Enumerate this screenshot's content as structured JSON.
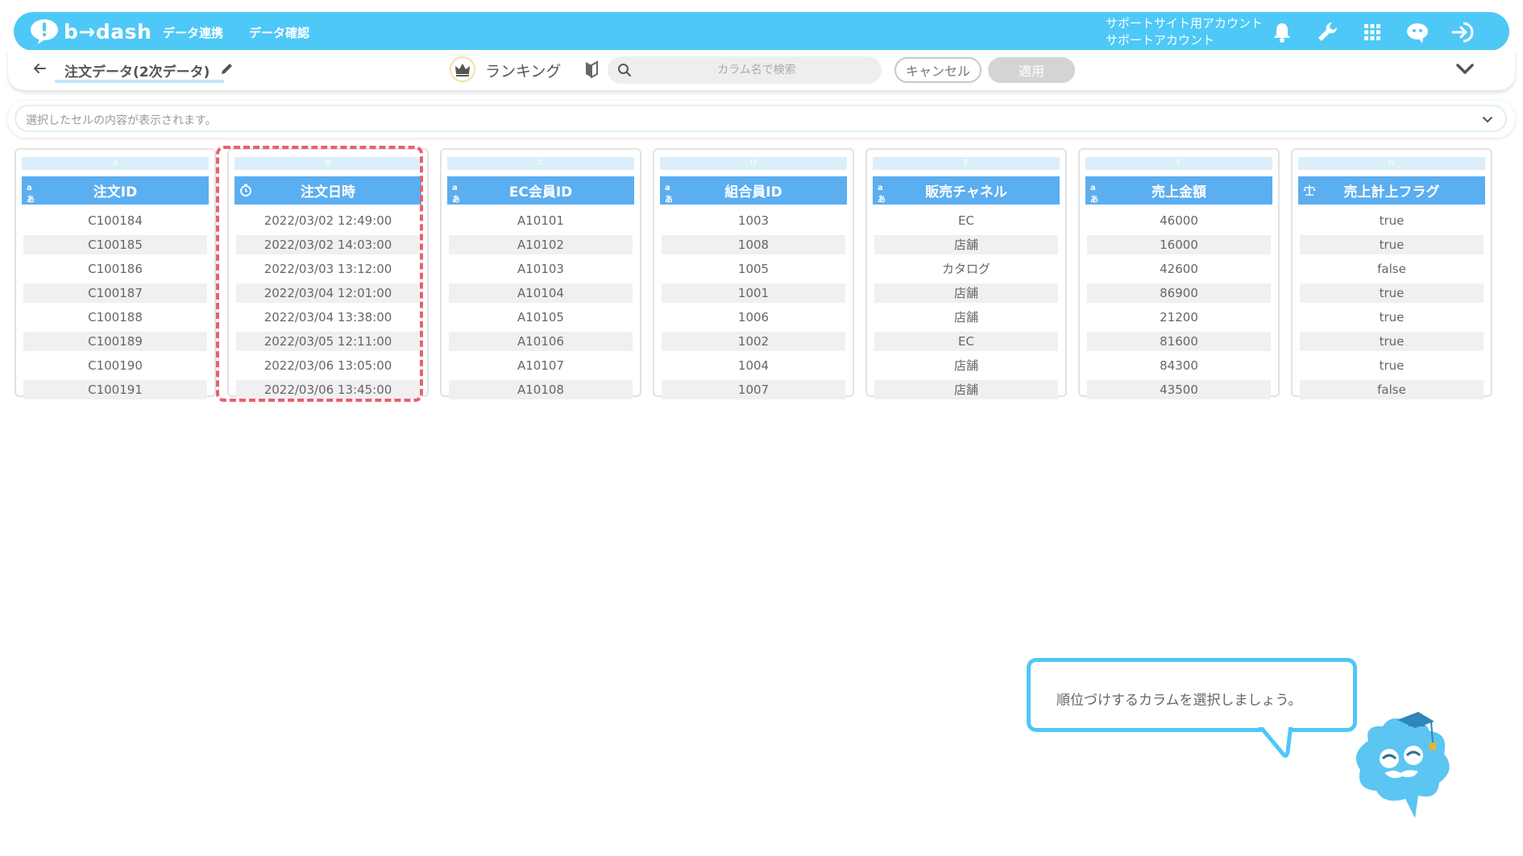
{
  "topbar": {
    "logo_text": "b→dash",
    "nav": [
      "データ連携",
      "データ確認"
    ],
    "account_line1": "サポートサイト用アカウント",
    "account_line2": "サポートアカウント",
    "icons": [
      "bell-icon",
      "wrench-icon",
      "grid-icon",
      "chat-icon",
      "logout-icon"
    ],
    "accent_color": "#4ec8f7"
  },
  "toolbar": {
    "title": "注文データ(2次データ)",
    "ranking_label": "ランキング",
    "search_placeholder": "カラム名で検索",
    "cancel_label": "キャンセル",
    "apply_label": "適用"
  },
  "cellbar": {
    "placeholder": "選択したセルの内容が表示されます。"
  },
  "columns": [
    {
      "letter": "A",
      "name": "注文ID",
      "type": "text",
      "cells": [
        "C100184",
        "C100185",
        "C100186",
        "C100187",
        "C100188",
        "C100189",
        "C100190",
        "C100191"
      ]
    },
    {
      "letter": "B",
      "name": "注文日時",
      "type": "datetime",
      "cells": [
        "2022/03/02 12:49:00",
        "2022/03/02 14:03:00",
        "2022/03/03 13:12:00",
        "2022/03/04 12:01:00",
        "2022/03/04 13:38:00",
        "2022/03/05 12:11:00",
        "2022/03/06 13:05:00",
        "2022/03/06 13:45:00"
      ]
    },
    {
      "letter": "C",
      "name": "EC会員ID",
      "type": "text",
      "cells": [
        "A10101",
        "A10102",
        "A10103",
        "A10104",
        "A10105",
        "A10106",
        "A10107",
        "A10108"
      ]
    },
    {
      "letter": "D",
      "name": "組合員ID",
      "type": "text",
      "cells": [
        "1003",
        "1008",
        "1005",
        "1001",
        "1006",
        "1002",
        "1004",
        "1007"
      ]
    },
    {
      "letter": "E",
      "name": "販売チャネル",
      "type": "text",
      "cells": [
        "EC",
        "店舗",
        "カタログ",
        "店舗",
        "店舗",
        "EC",
        "店舗",
        "店舗"
      ]
    },
    {
      "letter": "F",
      "name": "売上金額",
      "type": "text",
      "cells": [
        "46000",
        "16000",
        "42600",
        "86900",
        "21200",
        "81600",
        "84300",
        "43500"
      ]
    },
    {
      "letter": "G",
      "name": "売上計上フラグ",
      "type": "boolean",
      "cells": [
        "true",
        "true",
        "false",
        "true",
        "true",
        "true",
        "true",
        "false"
      ]
    }
  ],
  "type_badge_text": "aあ",
  "tooltip": {
    "text": "順位づけするカラムを選択しましょう。"
  }
}
